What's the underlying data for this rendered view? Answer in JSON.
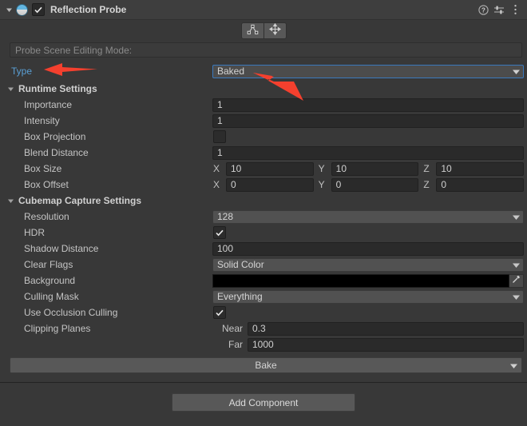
{
  "header": {
    "title": "Reflection Probe",
    "enabled_checkbox": true,
    "icon": "reflection-probe-sphere-icon",
    "right_icons": [
      "help-icon",
      "preset-icon",
      "more-menu-icon"
    ]
  },
  "toolbar": {
    "buttons": [
      {
        "name": "edit-bounds-icon",
        "active": false
      },
      {
        "name": "move-probe-icon",
        "active": false
      }
    ]
  },
  "probe_scene_mode": {
    "label": "Probe Scene Editing Mode:"
  },
  "type_row": {
    "label": "Type",
    "value": "Baked",
    "focused": true
  },
  "runtime_settings": {
    "title": "Runtime Settings",
    "expanded": true,
    "rows": [
      {
        "label": "Importance",
        "kind": "text",
        "value": "1"
      },
      {
        "label": "Intensity",
        "kind": "text",
        "value": "1"
      },
      {
        "label": "Box Projection",
        "kind": "checkbox",
        "checked": false
      },
      {
        "label": "Blend Distance",
        "kind": "text",
        "value": "1"
      },
      {
        "label": "Box Size",
        "kind": "vector3",
        "axes": [
          "X",
          "Y",
          "Z"
        ],
        "values": [
          "10",
          "10",
          "10"
        ]
      },
      {
        "label": "Box Offset",
        "kind": "vector3",
        "axes": [
          "X",
          "Y",
          "Z"
        ],
        "values": [
          "0",
          "0",
          "0"
        ]
      }
    ]
  },
  "cubemap_settings": {
    "title": "Cubemap Capture Settings",
    "expanded": true,
    "rows": [
      {
        "label": "Resolution",
        "kind": "dropdown",
        "value": "128"
      },
      {
        "label": "HDR",
        "kind": "checkbox",
        "checked": true
      },
      {
        "label": "Shadow Distance",
        "kind": "text",
        "value": "100"
      },
      {
        "label": "Clear Flags",
        "kind": "dropdown",
        "value": "Solid Color"
      },
      {
        "label": "Background",
        "kind": "color",
        "color": "#000000"
      },
      {
        "label": "Culling Mask",
        "kind": "dropdown",
        "value": "Everything"
      },
      {
        "label": "Use Occlusion Culling",
        "kind": "checkbox",
        "checked": true
      },
      {
        "label": "Clipping Planes",
        "kind": "clip",
        "near_label": "Near",
        "near_value": "0.3",
        "far_label": "Far",
        "far_value": "1000"
      }
    ]
  },
  "bake": {
    "label": "Bake"
  },
  "add_component": {
    "label": "Add Component"
  },
  "annotations": {
    "arrow_color": "#f4402e",
    "arrows": [
      {
        "name": "arrow-pointing-to-type-label",
        "target": "Type"
      },
      {
        "name": "arrow-pointing-to-baked-dropdown",
        "target": "Baked"
      }
    ]
  }
}
